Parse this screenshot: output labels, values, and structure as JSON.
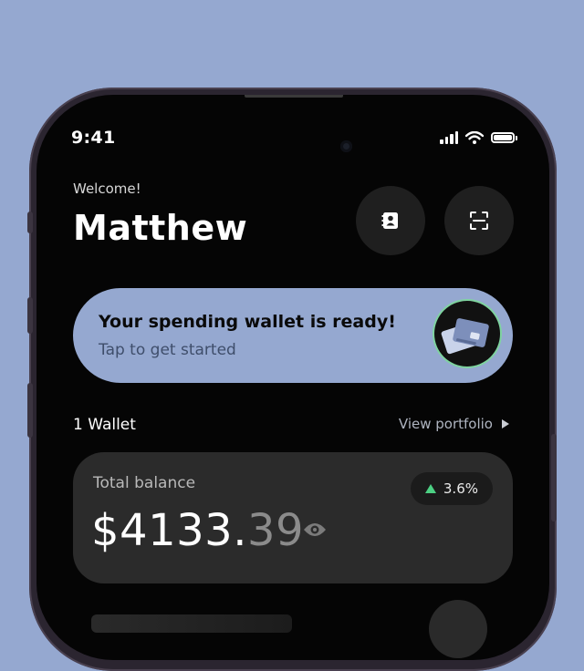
{
  "status_bar": {
    "time": "9:41",
    "icons": [
      "signal-icon",
      "wifi-icon",
      "battery-icon"
    ]
  },
  "header": {
    "greeting": "Welcome!",
    "name": "Matthew",
    "buttons": [
      {
        "icon": "contact-card-icon"
      },
      {
        "icon": "qr-scan-icon"
      }
    ]
  },
  "banner": {
    "title": "Your spending wallet is ready!",
    "subtitle": "Tap to get started",
    "icon": "wallet-cards-icon"
  },
  "wallets": {
    "count_label": "1 Wallet",
    "view_portfolio_label": "View portfolio"
  },
  "balance": {
    "label": "Total balance",
    "whole": "$4133.",
    "cents": "39",
    "change": "3.6%"
  },
  "colors": {
    "background": "#95a8d0",
    "accent": "#95a8d0",
    "positive": "#4cd083",
    "card": "#2b2b2b"
  }
}
